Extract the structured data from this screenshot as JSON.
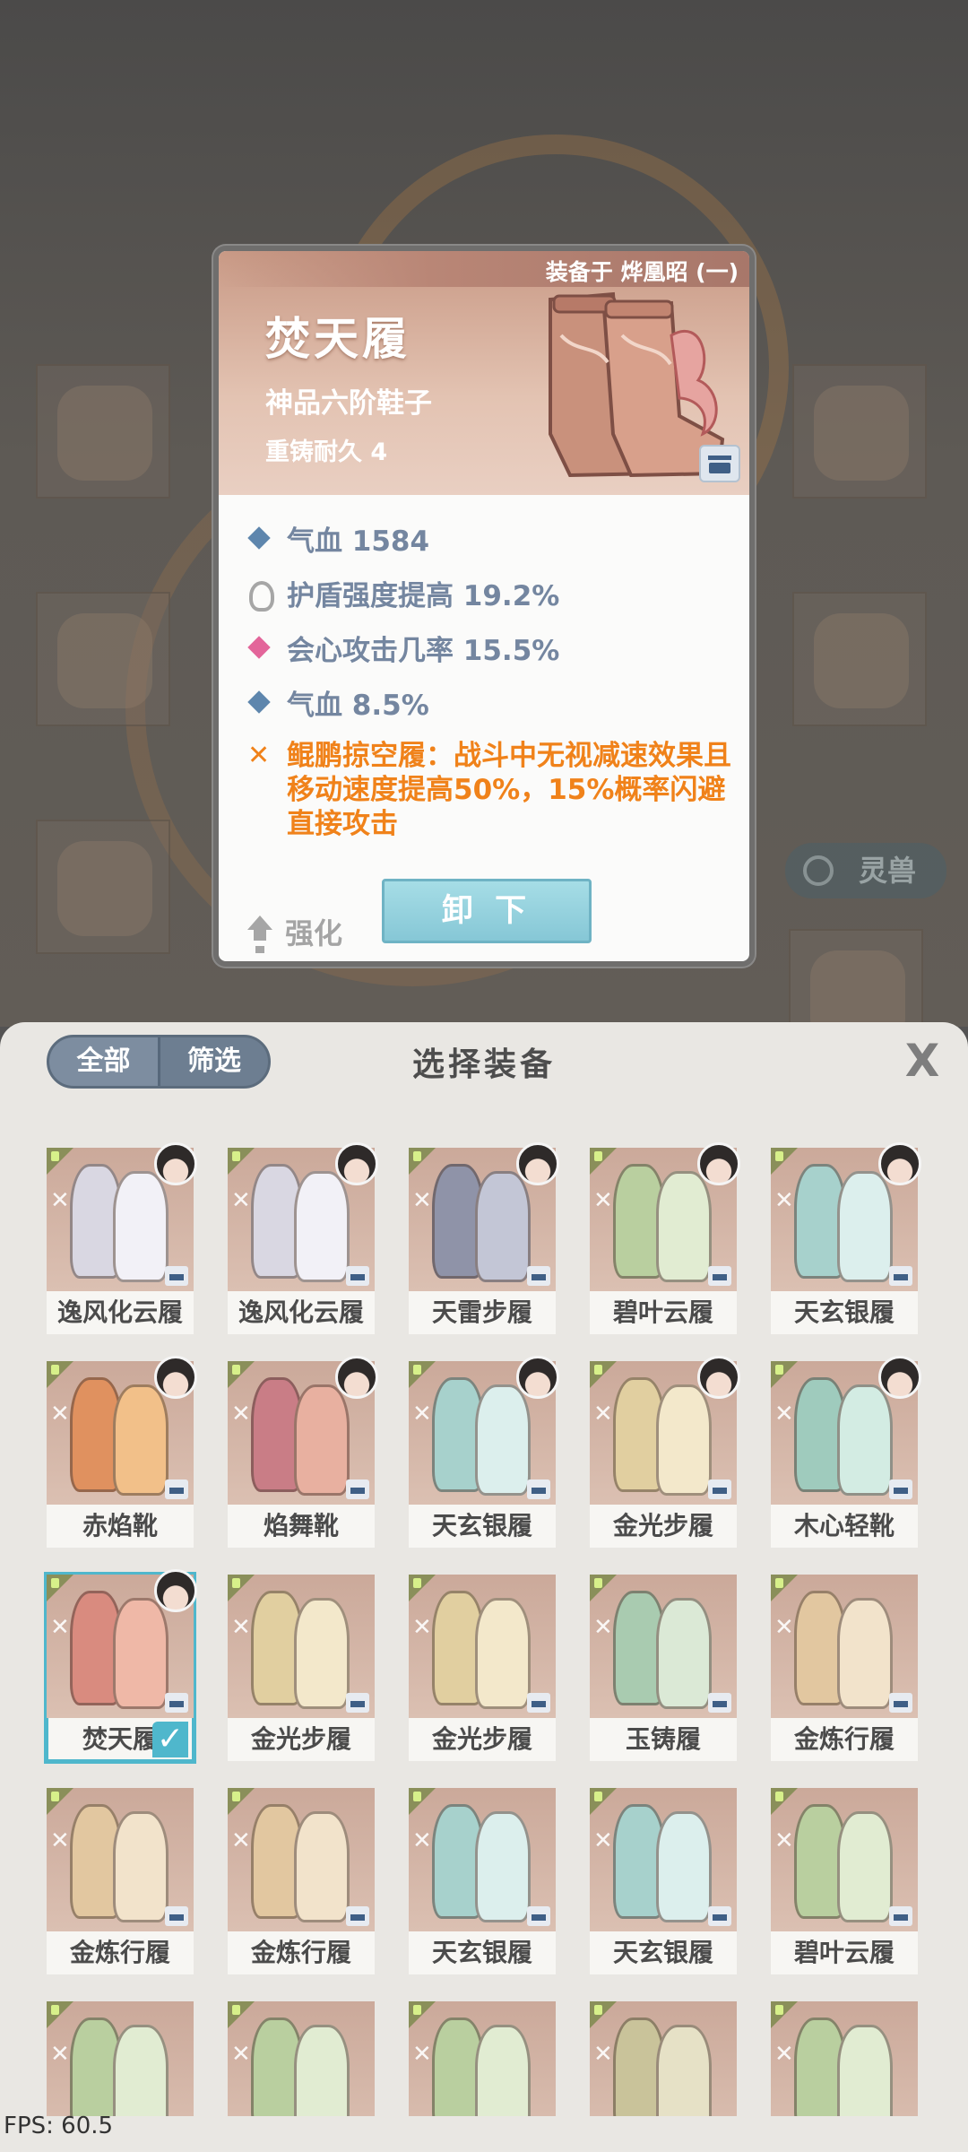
{
  "detail": {
    "equipped_on": "装备于 烨凰昭 (一)",
    "name": "焚天履",
    "grade": "神品六阶鞋子",
    "reforge": "重铸耐久 4",
    "stats": [
      {
        "text": "气血 1584",
        "icon": "diamond-blue"
      },
      {
        "text": "护盾强度提高 19.2%",
        "icon": "shield"
      },
      {
        "text": "会心攻击几率 15.5%",
        "icon": "diamond-pink"
      },
      {
        "text": "气血 8.5%",
        "icon": "diamond-blue"
      }
    ],
    "special": "鲲鹏掠空履：战斗中无视减速效果且移动速度提高50%，15%概率闪避直接攻击",
    "enhance_label": "强化",
    "unequip_label": "卸 下"
  },
  "background": {
    "pet_button_label": "灵兽"
  },
  "panel": {
    "tab_all": "全部",
    "tab_filter": "筛选",
    "title": "选择装备",
    "close": "X"
  },
  "items": [
    {
      "name": "逸风化云履",
      "tone": "#d9d7e2",
      "accent": "#f2f1f7",
      "avatar": true
    },
    {
      "name": "逸风化云履",
      "tone": "#d9d7e2",
      "accent": "#f2f1f7",
      "avatar": true
    },
    {
      "name": "天雷步履",
      "tone": "#8f93a8",
      "accent": "#c3c6d6",
      "avatar": true
    },
    {
      "name": "碧叶云履",
      "tone": "#b9cf9f",
      "accent": "#e1ecd2",
      "avatar": true
    },
    {
      "name": "天玄银履",
      "tone": "#a7d1cc",
      "accent": "#dcefed",
      "avatar": true
    },
    {
      "name": "赤焰靴",
      "tone": "#e0915f",
      "accent": "#f2c089",
      "avatar": true
    },
    {
      "name": "焰舞靴",
      "tone": "#c97d86",
      "accent": "#e8b0a0",
      "avatar": true
    },
    {
      "name": "天玄银履",
      "tone": "#a7d1cc",
      "accent": "#dcefed",
      "avatar": true
    },
    {
      "name": "金光步履",
      "tone": "#e1cfa0",
      "accent": "#f3e8cb",
      "avatar": true
    },
    {
      "name": "木心轻靴",
      "tone": "#9fcbbd",
      "accent": "#d3ece3",
      "avatar": true
    },
    {
      "name": "焚天履",
      "tone": "#d98b7f",
      "accent": "#efb8a7",
      "avatar": true,
      "selected": true
    },
    {
      "name": "金光步履",
      "tone": "#e1cfa0",
      "accent": "#f3e8cb",
      "avatar": false
    },
    {
      "name": "金光步履",
      "tone": "#e1cfa0",
      "accent": "#f3e8cb",
      "avatar": false
    },
    {
      "name": "玉铸履",
      "tone": "#a9cbb0",
      "accent": "#dbe9d6",
      "avatar": false
    },
    {
      "name": "金炼行履",
      "tone": "#e2c7a0",
      "accent": "#f2e3cb",
      "avatar": false
    },
    {
      "name": "金炼行履",
      "tone": "#e2c7a0",
      "accent": "#f2e3cb",
      "avatar": false
    },
    {
      "name": "金炼行履",
      "tone": "#e2c7a0",
      "accent": "#f2e3cb",
      "avatar": false
    },
    {
      "name": "天玄银履",
      "tone": "#a7d1cc",
      "accent": "#dcefed",
      "avatar": false
    },
    {
      "name": "天玄银履",
      "tone": "#a7d1cc",
      "accent": "#dcefed",
      "avatar": false
    },
    {
      "name": "碧叶云履",
      "tone": "#b9cf9f",
      "accent": "#e1ecd2",
      "avatar": false
    },
    {
      "name": "",
      "tone": "#b9cf9f",
      "accent": "#e1ecd2",
      "avatar": false
    },
    {
      "name": "",
      "tone": "#b9cf9f",
      "accent": "#e1ecd2",
      "avatar": false
    },
    {
      "name": "",
      "tone": "#b9cf9f",
      "accent": "#e1ecd2",
      "avatar": false
    },
    {
      "name": "",
      "tone": "#c9c39a",
      "accent": "#e6e1c6",
      "avatar": false
    },
    {
      "name": "",
      "tone": "#b9cf9f",
      "accent": "#e1ecd2",
      "avatar": false
    }
  ],
  "fps": "FPS: 60.5"
}
